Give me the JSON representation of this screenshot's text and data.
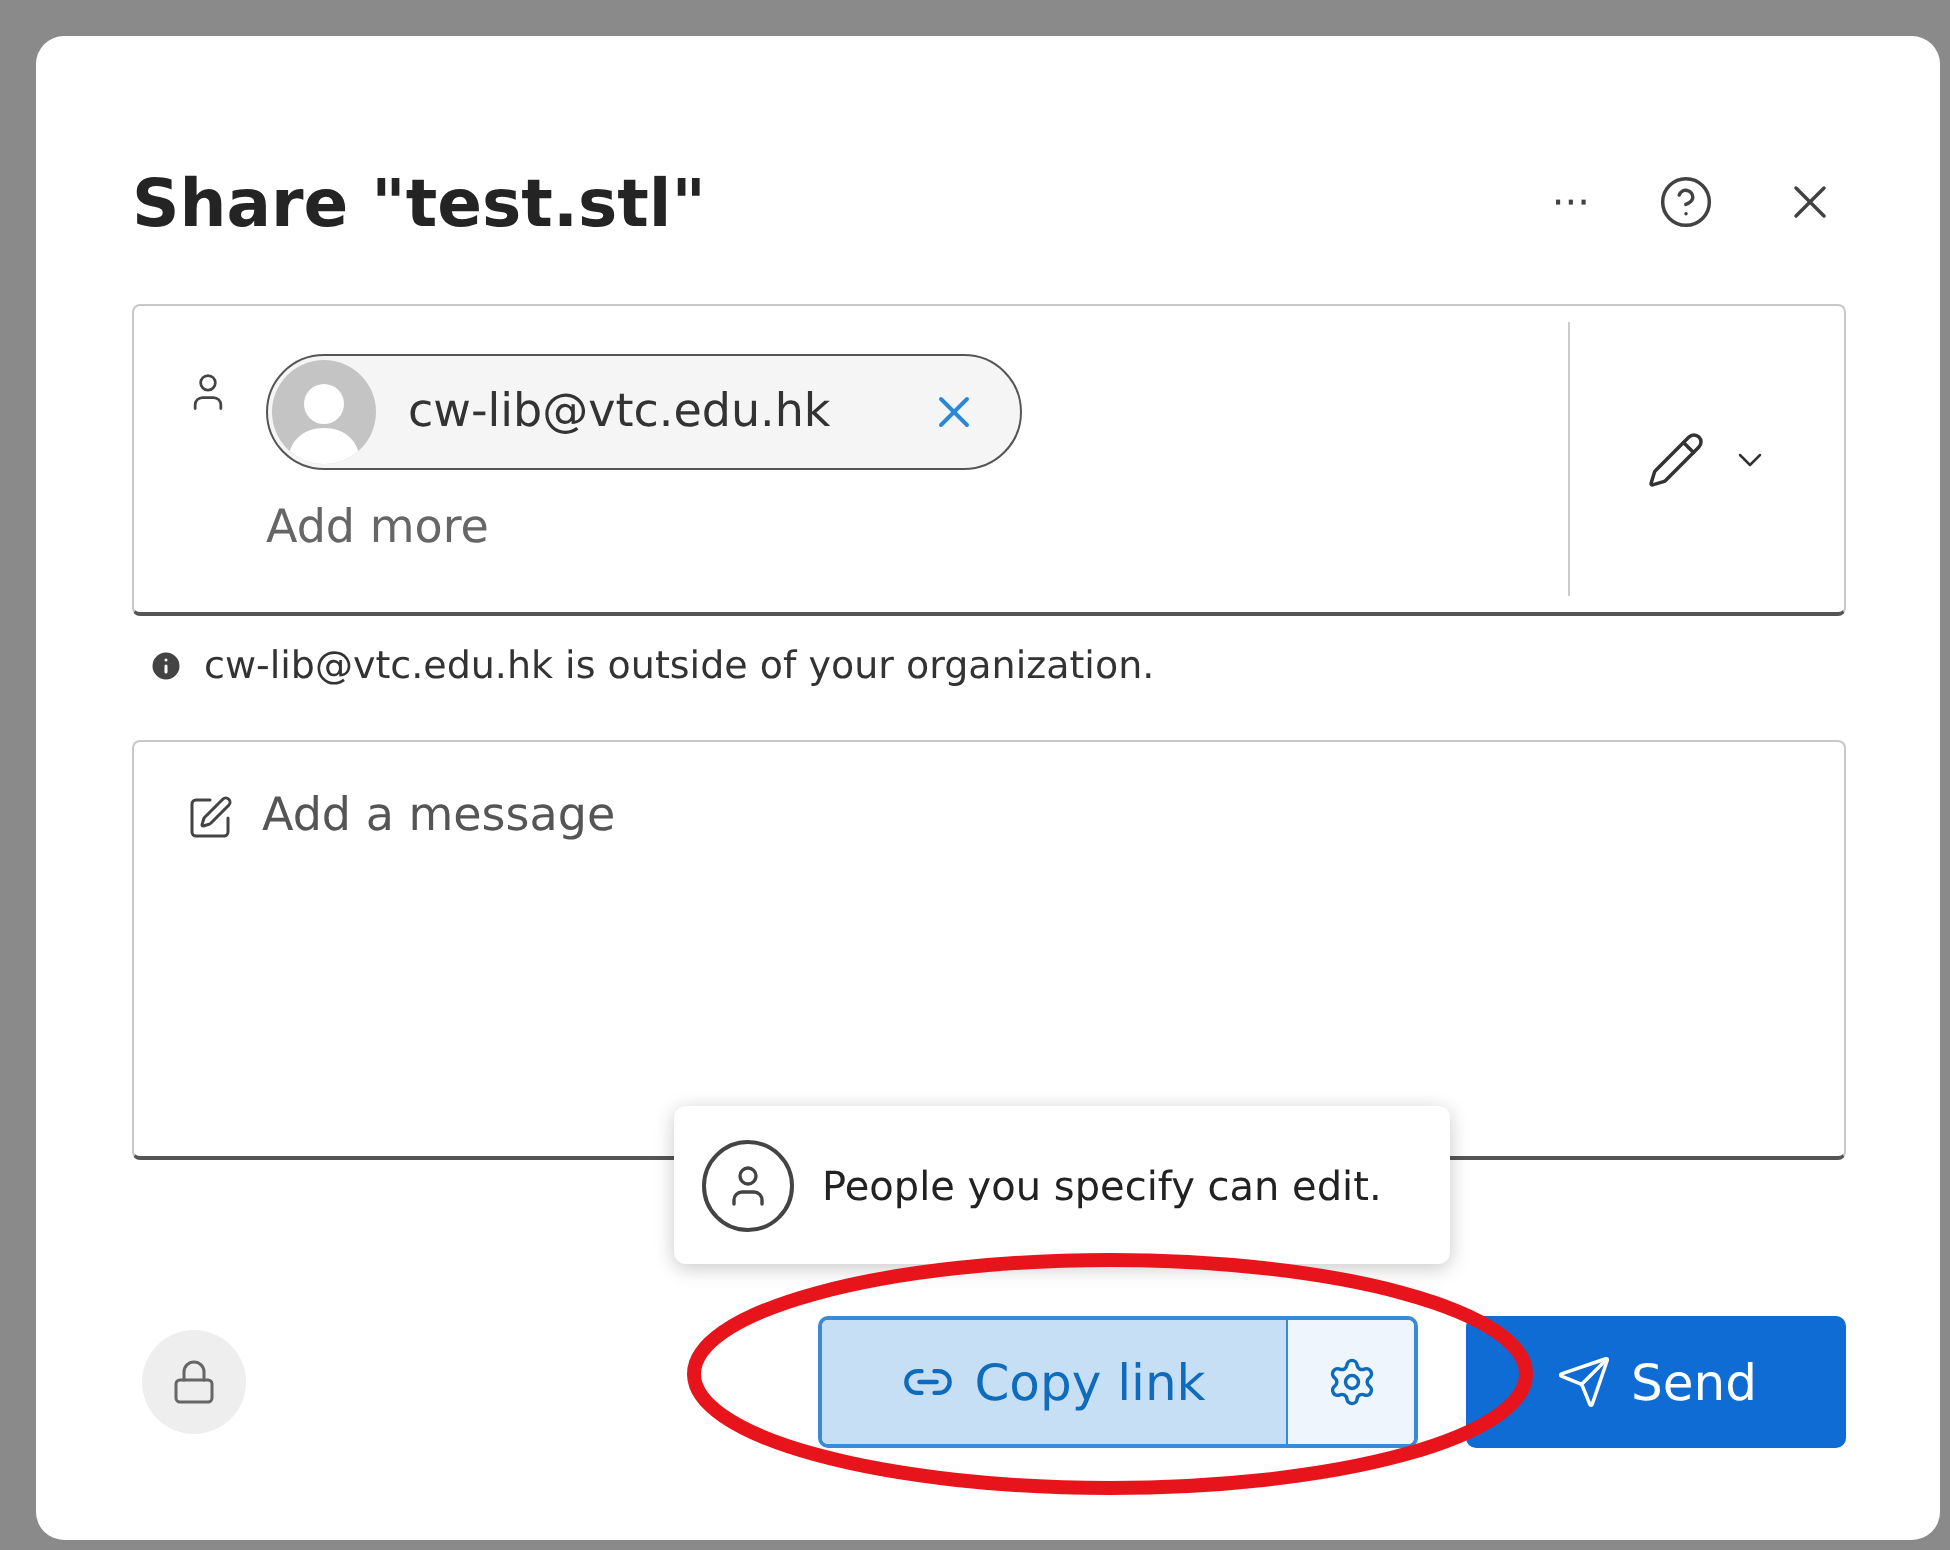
{
  "dialog": {
    "title": "Share \"test.stl\"",
    "more_label": "···"
  },
  "recipients": {
    "chips": [
      {
        "email": "cw-lib@vtc.edu.hk"
      }
    ],
    "placeholder": "Add more"
  },
  "notice": "cw-lib@vtc.edu.hk is outside of your organization.",
  "message": {
    "placeholder": "Add a message"
  },
  "tooltip": "People you specify can edit.",
  "footer": {
    "copy_link": "Copy link",
    "send": "Send"
  },
  "annotation": {
    "kind": "ellipse",
    "color": "#e8141b"
  }
}
